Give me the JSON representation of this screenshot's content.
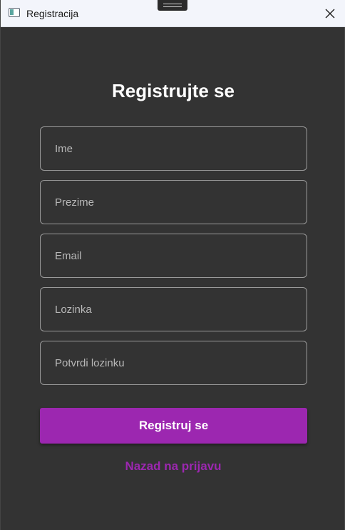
{
  "window": {
    "title": "Registracija",
    "icon": "app-window-icon",
    "close_icon": "close-icon"
  },
  "form": {
    "heading": "Registrujte se",
    "fields": [
      {
        "name": "first-name",
        "placeholder": "Ime",
        "value": ""
      },
      {
        "name": "last-name",
        "placeholder": "Prezime",
        "value": ""
      },
      {
        "name": "email",
        "placeholder": "Email",
        "value": ""
      },
      {
        "name": "password",
        "placeholder": "Lozinka",
        "value": ""
      },
      {
        "name": "confirm-password",
        "placeholder": "Potvrdi lozinku",
        "value": ""
      }
    ],
    "submit_label": "Registruj se",
    "back_link": "Nazad na prijavu"
  },
  "colors": {
    "background": "#333333",
    "accent": "#9c27b0",
    "field_border": "#9a9a9a",
    "titlebar": "#f3f5fb"
  }
}
